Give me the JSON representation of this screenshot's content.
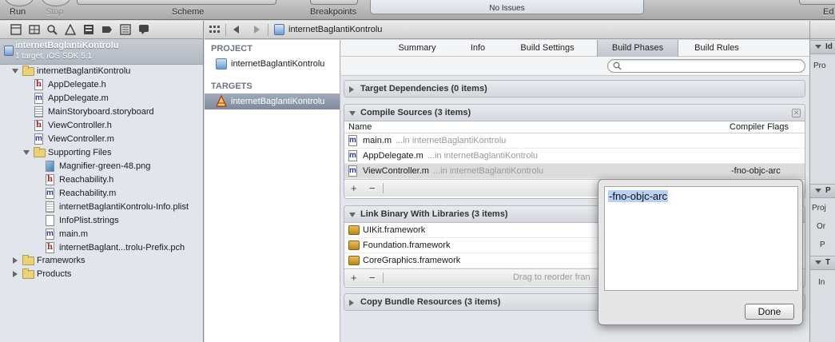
{
  "toolbar": {
    "run_label": "Run",
    "stop_label": "Stop",
    "scheme_label": "Scheme",
    "breakpoints_label": "Breakpoints",
    "status_text": "No Issues",
    "editor_label": "Ed"
  },
  "navigator": {
    "project": {
      "name": "internetBaglantiKontrolu",
      "subtitle": "1 target, iOS SDK 5.1"
    },
    "items": [
      {
        "label": "internetBaglantiKontrolu",
        "kind": "folder"
      },
      {
        "label": "AppDelegate.h",
        "kind": "h"
      },
      {
        "label": "AppDelegate.m",
        "kind": "m"
      },
      {
        "label": "MainStoryboard.storyboard",
        "kind": "storyboard"
      },
      {
        "label": "ViewController.h",
        "kind": "h"
      },
      {
        "label": "ViewController.m",
        "kind": "m"
      },
      {
        "label": "Supporting Files",
        "kind": "folder"
      },
      {
        "label": "Magnifier-green-48.png",
        "kind": "png"
      },
      {
        "label": "Reachability.h",
        "kind": "h"
      },
      {
        "label": "Reachability.m",
        "kind": "m"
      },
      {
        "label": "internetBaglantiKontrolu-Info.plist",
        "kind": "plist"
      },
      {
        "label": "InfoPlist.strings",
        "kind": "strings"
      },
      {
        "label": "main.m",
        "kind": "m"
      },
      {
        "label": "internetBaglant...trolu-Prefix.pch",
        "kind": "h"
      },
      {
        "label": "Frameworks",
        "kind": "folder"
      },
      {
        "label": "Products",
        "kind": "folder"
      }
    ]
  },
  "jumpbar": {
    "crumb": "internetBaglantiKontrolu"
  },
  "targets_pane": {
    "project_heading": "PROJECT",
    "project_item": "internetBaglantiKontrolu",
    "targets_heading": "TARGETS",
    "target_item": "internetBaglantiKontrolu"
  },
  "tabs": [
    "Summary",
    "Info",
    "Build Settings",
    "Build Phases",
    "Build Rules"
  ],
  "active_tab": "Build Phases",
  "filter": {
    "placeholder": ""
  },
  "phases": {
    "target_dependencies": {
      "title": "Target Dependencies (0 items)"
    },
    "compile_sources": {
      "title": "Compile Sources (3 items)",
      "col_name": "Name",
      "col_flags": "Compiler Flags",
      "rows": [
        {
          "name": "main.m",
          "path": "...in internetBaglantiKontrolu",
          "flags": ""
        },
        {
          "name": "AppDelegate.m",
          "path": "...in internetBaglantiKontrolu",
          "flags": ""
        },
        {
          "name": "ViewController.m",
          "path": "...in internetBaglantiKontrolu",
          "flags": "-fno-objc-arc"
        }
      ],
      "add": "+",
      "remove": "−"
    },
    "link_binary": {
      "title": "Link Binary With Libraries (3 items)",
      "rows": [
        {
          "name": "UIKit.framework"
        },
        {
          "name": "Foundation.framework"
        },
        {
          "name": "CoreGraphics.framework"
        }
      ],
      "add": "+",
      "remove": "−",
      "drag_hint": "Drag to reorder fran"
    },
    "copy_bundle": {
      "title": "Copy Bundle Resources (3 items)"
    }
  },
  "popover": {
    "flags_value": "-fno-objc-arc",
    "done_label": "Done"
  },
  "utility": {
    "h1": "Id",
    "l1": "Pro",
    "h2": "P",
    "l2": "Proj",
    "l3": "Or",
    "l4": "P",
    "h3": "T",
    "l5": "In"
  }
}
